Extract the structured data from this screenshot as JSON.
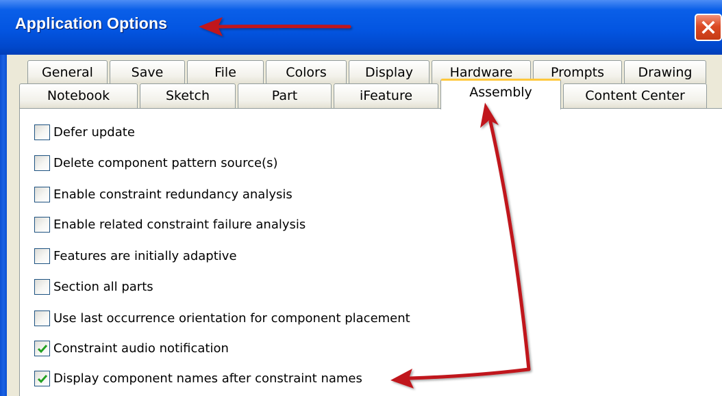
{
  "window": {
    "title": "Application Options"
  },
  "title_bar": {
    "close_icon": "close-icon",
    "close_color": "#d9512c"
  },
  "tabs": {
    "row1": [
      "General",
      "Save",
      "File",
      "Colors",
      "Display",
      "Hardware",
      "Prompts",
      "Drawing"
    ],
    "row2": [
      "Notebook",
      "Sketch",
      "Part",
      "iFeature",
      "Assembly",
      "Content Center"
    ],
    "active": "Assembly",
    "active_highlight_color": "#ffc83c"
  },
  "options": [
    {
      "label": "Defer update",
      "checked": false
    },
    {
      "label": "Delete component pattern source(s)",
      "checked": false
    },
    {
      "label": "Enable constraint redundancy analysis",
      "checked": false
    },
    {
      "label": "Enable related constraint failure analysis",
      "checked": false
    },
    {
      "label": "Features are initially adaptive",
      "checked": false
    },
    {
      "label": "Section all parts",
      "checked": false
    },
    {
      "label": "Use last occurrence orientation for component placement",
      "checked": false
    },
    {
      "label": "Constraint audio notification",
      "checked": true
    },
    {
      "label": "Display component names after constraint names",
      "checked": true
    }
  ],
  "annotations": {
    "arrow_color": "#c0161b"
  },
  "colors": {
    "title_bar": "#0355e1",
    "dialog_face": "#ece9d8",
    "check_mark": "#21a121"
  }
}
